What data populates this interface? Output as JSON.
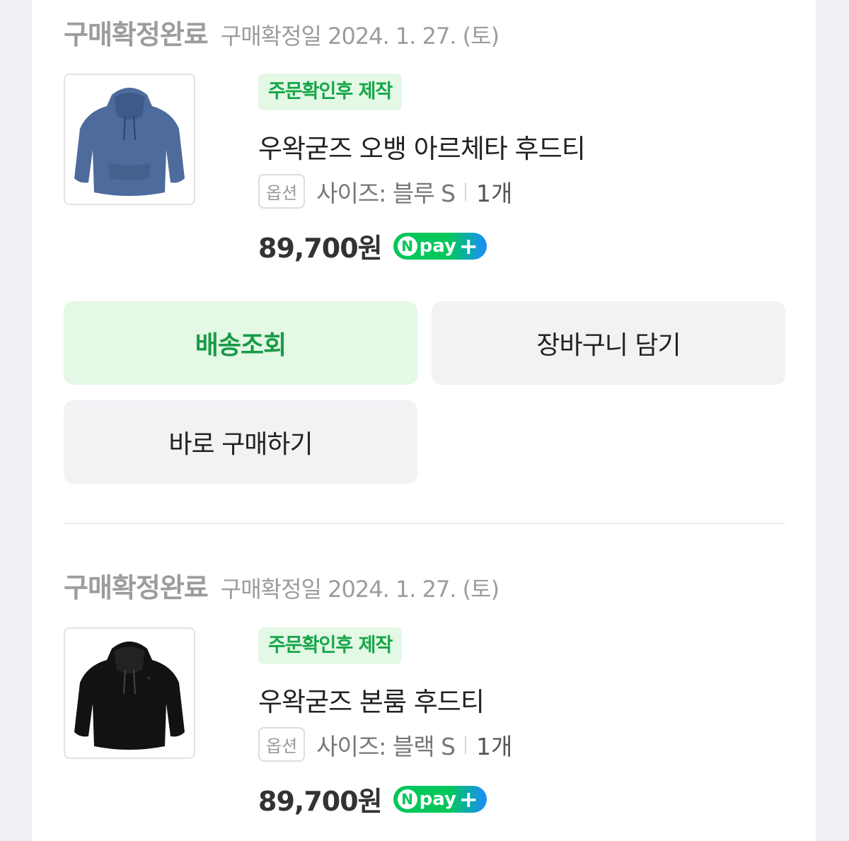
{
  "orders": [
    {
      "status": "구매확정완료",
      "confirm_date": "구매확정일 2024. 1. 27. (토)",
      "image_icon": "hoodie-blue-icon",
      "badge": "주문확인후 제작",
      "product_name": "우왁굳즈 오뱅 아르체타 후드티",
      "option_label": "옵션",
      "option_value": "사이즈: 블루 S",
      "quantity": "1개",
      "price": "89,700원",
      "npay": {
        "n": "N",
        "text": "pay",
        "plus": "+"
      },
      "buttons": {
        "track": "배송조회",
        "cart": "장바구니 담기",
        "buy_now": "바로 구매하기"
      }
    },
    {
      "status": "구매확정완료",
      "confirm_date": "구매확정일 2024. 1. 27. (토)",
      "image_icon": "hoodie-black-icon",
      "badge": "주문확인후 제작",
      "product_name": "우왁굳즈 본룸 후드티",
      "option_label": "옵션",
      "option_value": "사이즈: 블랙 S",
      "quantity": "1개",
      "price": "89,700원",
      "npay": {
        "n": "N",
        "text": "pay",
        "plus": "+"
      }
    }
  ],
  "colors": {
    "accent_green": "#17a64a",
    "badge_bg": "#e3f8e5",
    "hoodie_blue": "#4d6b9c",
    "hoodie_black": "#121212"
  }
}
